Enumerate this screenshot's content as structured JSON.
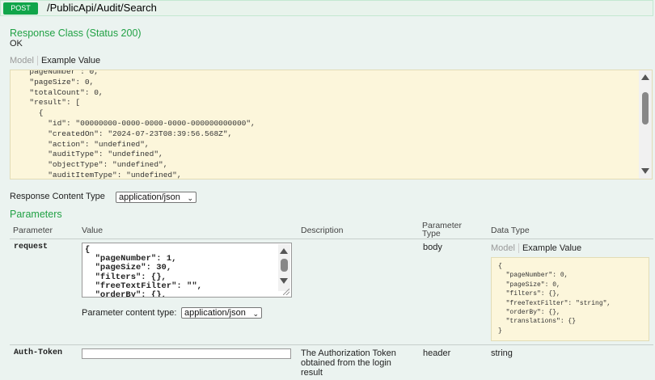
{
  "operation": {
    "method": "POST",
    "path": "/PublicApi/Audit/Search"
  },
  "response": {
    "class_label": "Response Class (Status 200)",
    "status_text": "OK",
    "tabs": {
      "model": "Model",
      "example": "Example Value"
    },
    "example_lines": [
      "  pageNumber : 0,",
      "  \"pageSize\": 0,",
      "  \"totalCount\": 0,",
      "  \"result\": [",
      "    {",
      "      \"id\": \"00000000-0000-0000-0000-000000000000\",",
      "      \"createdOn\": \"2024-07-23T08:39:56.568Z\",",
      "      \"action\": \"undefined\",",
      "      \"auditType\": \"undefined\",",
      "      \"objectType\": \"undefined\",",
      "      \"auditItemType\": \"undefined\","
    ],
    "content_type_label": "Response Content Type",
    "content_type_value": "application/json"
  },
  "parameters": {
    "title": "Parameters",
    "headers": {
      "parameter": "Parameter",
      "value": "Value",
      "description": "Description",
      "parameter_type_line1": "Parameter",
      "parameter_type_line2": "Type",
      "data_type": "Data Type"
    },
    "rows": [
      {
        "name": "request",
        "value_lines": [
          "{",
          "  \"pageNumber\": 1,",
          "  \"pageSize\": 30,",
          "  \"filters\": {},",
          "  \"freeTextFilter\": \"\",",
          "  \"orderBy\": {},"
        ],
        "content_type_label": "Parameter content type:",
        "content_type_value": "application/json",
        "param_type": "body",
        "data_type_tabs": {
          "model": "Model",
          "example": "Example Value"
        },
        "data_type_lines": [
          "{",
          "  \"pageNumber\": 0,",
          "  \"pageSize\": 0,",
          "  \"filters\": {},",
          "  \"freeTextFilter\": \"string\",",
          "  \"orderBy\": {},",
          "  \"translations\": {}",
          "}"
        ]
      },
      {
        "name": "Auth-Token",
        "value": "",
        "description_lines": [
          "The Authorization Token",
          "obtained from the login",
          "result"
        ],
        "param_type": "header",
        "data_type": "string"
      }
    ]
  }
}
